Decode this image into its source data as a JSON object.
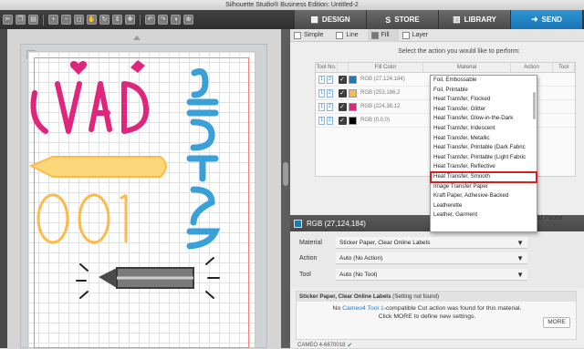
{
  "window": {
    "title": "Silhouette Studio® Business Edition: Untitled-2"
  },
  "nav_tabs": [
    {
      "label": "DESIGN",
      "icon": "design-icon"
    },
    {
      "label": "STORE",
      "icon": "store-icon"
    },
    {
      "label": "LIBRARY",
      "icon": "library-icon"
    },
    {
      "label": "SEND",
      "icon": "send-icon",
      "active": true
    }
  ],
  "toolbar_icons": [
    "cut-icon",
    "copy-icon",
    "paste-icon",
    "zoom-in-icon",
    "zoom-out-icon",
    "zoom-fit-icon",
    "pan-icon",
    "redraw-icon",
    "drag-icon",
    "move-icon",
    "undo-icon",
    "redo-icon",
    "fill-icon",
    "zoom-selection-icon"
  ],
  "panel_tabs": [
    {
      "label": "Simple",
      "active": false
    },
    {
      "label": "Line",
      "active": false
    },
    {
      "label": "Fill",
      "active": true
    },
    {
      "label": "Layer",
      "active": false
    }
  ],
  "instruction": "Select the action you would like to perform:",
  "table": {
    "headers": [
      "Tool No.",
      "",
      "Fill Color",
      "Material",
      "Action",
      "Tool"
    ],
    "rows": [
      {
        "tool_numbers": [
          "1",
          "2"
        ],
        "checked": true,
        "color": "#1b7bb8",
        "label": "RGB (27,124,184)"
      },
      {
        "tool_numbers": [
          "1",
          "2"
        ],
        "checked": true,
        "color": "#fdba48",
        "label": "RGB (253,186,2"
      },
      {
        "tool_numbers": [
          "1",
          "2"
        ],
        "checked": true,
        "color": "#e0267c",
        "label": "RGB (224,38,12"
      },
      {
        "tool_numbers": [
          "1",
          "2"
        ],
        "checked": true,
        "color": "#000000",
        "label": "RGB (0,0,0)"
      }
    ]
  },
  "material_options": [
    "Foil, Embossable",
    "Foil, Printable",
    "Heat Transfer, Flocked",
    "Heat Transfer, Glitter",
    "Heat Transfer, Glow-in-the-Dark",
    "Heat Transfer, Iridescent",
    "Heat Transfer, Metallic",
    "Heat Transfer, Printable (Dark Fabric",
    "Heat Transfer, Printable (Light Fabric",
    "Heat Transfer, Reflective",
    "Heat Transfer, Smooth",
    "Image Transfer Paper",
    "Kraft Paper, Adhesive-Backed",
    "Leatherette",
    "Leather, Garment"
  ],
  "highlighted_option": "Heat Transfer, Smooth",
  "add_pause_label": "dd Pause",
  "selected_color_bar": {
    "label": "RGB (27,124,184)",
    "color": "#1b7bb8"
  },
  "settings": {
    "material_label": "Material",
    "material_value": "Sticker Paper, Clear Online Labels",
    "action_label": "Action",
    "action_value": "Auto (No Action)",
    "tool_label": "Tool",
    "tool_value": "Auto (No Tool)"
  },
  "not_found": {
    "heading": "Sticker Paper, Clear Online Labels",
    "heading_suffix": "(Setting not found)",
    "message_prefix": "No ",
    "device_link": "Cameo4 Tool 1",
    "message_suffix": "-compatible Cut action was found for this material.",
    "message_line2": "Click MORE to define new settings.",
    "more_button": "MORE"
  },
  "status": {
    "device": "CAMEO 4-6670018"
  },
  "design": {
    "word_days": "DAYS",
    "number_100": "100",
    "word_smarter": "smarter",
    "colors": {
      "pink": "#e0267c",
      "yellow": "#fdba48",
      "blue": "#3aa0d8",
      "gray": "#4a4a4a"
    }
  }
}
